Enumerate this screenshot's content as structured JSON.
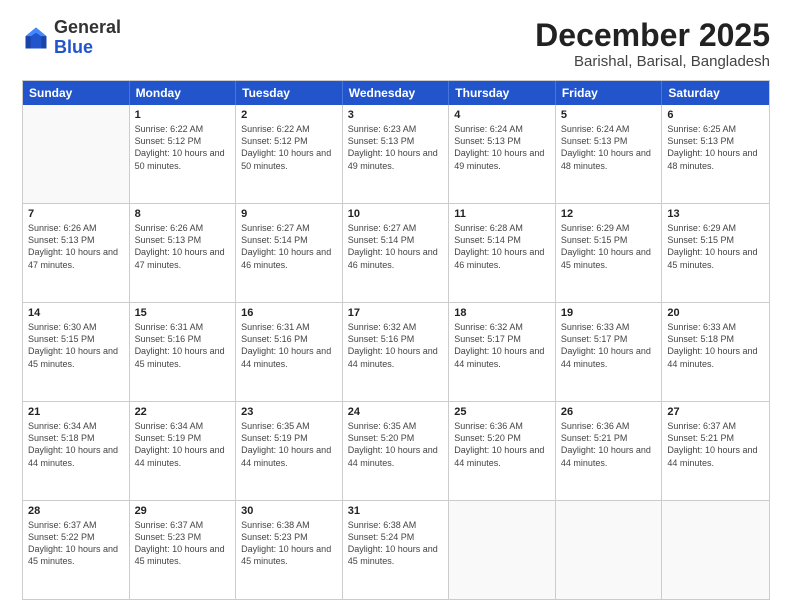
{
  "header": {
    "logo": {
      "line1": "General",
      "line2": "Blue"
    },
    "title": "December 2025",
    "location": "Barishal, Barisal, Bangladesh"
  },
  "weekdays": [
    "Sunday",
    "Monday",
    "Tuesday",
    "Wednesday",
    "Thursday",
    "Friday",
    "Saturday"
  ],
  "weeks": [
    [
      {
        "day": "",
        "empty": true
      },
      {
        "day": "1",
        "sunrise": "6:22 AM",
        "sunset": "5:12 PM",
        "daylight": "10 hours and 50 minutes."
      },
      {
        "day": "2",
        "sunrise": "6:22 AM",
        "sunset": "5:12 PM",
        "daylight": "10 hours and 50 minutes."
      },
      {
        "day": "3",
        "sunrise": "6:23 AM",
        "sunset": "5:13 PM",
        "daylight": "10 hours and 49 minutes."
      },
      {
        "day": "4",
        "sunrise": "6:24 AM",
        "sunset": "5:13 PM",
        "daylight": "10 hours and 49 minutes."
      },
      {
        "day": "5",
        "sunrise": "6:24 AM",
        "sunset": "5:13 PM",
        "daylight": "10 hours and 48 minutes."
      },
      {
        "day": "6",
        "sunrise": "6:25 AM",
        "sunset": "5:13 PM",
        "daylight": "10 hours and 48 minutes."
      }
    ],
    [
      {
        "day": "7",
        "sunrise": "6:26 AM",
        "sunset": "5:13 PM",
        "daylight": "10 hours and 47 minutes."
      },
      {
        "day": "8",
        "sunrise": "6:26 AM",
        "sunset": "5:13 PM",
        "daylight": "10 hours and 47 minutes."
      },
      {
        "day": "9",
        "sunrise": "6:27 AM",
        "sunset": "5:14 PM",
        "daylight": "10 hours and 46 minutes."
      },
      {
        "day": "10",
        "sunrise": "6:27 AM",
        "sunset": "5:14 PM",
        "daylight": "10 hours and 46 minutes."
      },
      {
        "day": "11",
        "sunrise": "6:28 AM",
        "sunset": "5:14 PM",
        "daylight": "10 hours and 46 minutes."
      },
      {
        "day": "12",
        "sunrise": "6:29 AM",
        "sunset": "5:15 PM",
        "daylight": "10 hours and 45 minutes."
      },
      {
        "day": "13",
        "sunrise": "6:29 AM",
        "sunset": "5:15 PM",
        "daylight": "10 hours and 45 minutes."
      }
    ],
    [
      {
        "day": "14",
        "sunrise": "6:30 AM",
        "sunset": "5:15 PM",
        "daylight": "10 hours and 45 minutes."
      },
      {
        "day": "15",
        "sunrise": "6:31 AM",
        "sunset": "5:16 PM",
        "daylight": "10 hours and 45 minutes."
      },
      {
        "day": "16",
        "sunrise": "6:31 AM",
        "sunset": "5:16 PM",
        "daylight": "10 hours and 44 minutes."
      },
      {
        "day": "17",
        "sunrise": "6:32 AM",
        "sunset": "5:16 PM",
        "daylight": "10 hours and 44 minutes."
      },
      {
        "day": "18",
        "sunrise": "6:32 AM",
        "sunset": "5:17 PM",
        "daylight": "10 hours and 44 minutes."
      },
      {
        "day": "19",
        "sunrise": "6:33 AM",
        "sunset": "5:17 PM",
        "daylight": "10 hours and 44 minutes."
      },
      {
        "day": "20",
        "sunrise": "6:33 AM",
        "sunset": "5:18 PM",
        "daylight": "10 hours and 44 minutes."
      }
    ],
    [
      {
        "day": "21",
        "sunrise": "6:34 AM",
        "sunset": "5:18 PM",
        "daylight": "10 hours and 44 minutes."
      },
      {
        "day": "22",
        "sunrise": "6:34 AM",
        "sunset": "5:19 PM",
        "daylight": "10 hours and 44 minutes."
      },
      {
        "day": "23",
        "sunrise": "6:35 AM",
        "sunset": "5:19 PM",
        "daylight": "10 hours and 44 minutes."
      },
      {
        "day": "24",
        "sunrise": "6:35 AM",
        "sunset": "5:20 PM",
        "daylight": "10 hours and 44 minutes."
      },
      {
        "day": "25",
        "sunrise": "6:36 AM",
        "sunset": "5:20 PM",
        "daylight": "10 hours and 44 minutes."
      },
      {
        "day": "26",
        "sunrise": "6:36 AM",
        "sunset": "5:21 PM",
        "daylight": "10 hours and 44 minutes."
      },
      {
        "day": "27",
        "sunrise": "6:37 AM",
        "sunset": "5:21 PM",
        "daylight": "10 hours and 44 minutes."
      }
    ],
    [
      {
        "day": "28",
        "sunrise": "6:37 AM",
        "sunset": "5:22 PM",
        "daylight": "10 hours and 45 minutes."
      },
      {
        "day": "29",
        "sunrise": "6:37 AM",
        "sunset": "5:23 PM",
        "daylight": "10 hours and 45 minutes."
      },
      {
        "day": "30",
        "sunrise": "6:38 AM",
        "sunset": "5:23 PM",
        "daylight": "10 hours and 45 minutes."
      },
      {
        "day": "31",
        "sunrise": "6:38 AM",
        "sunset": "5:24 PM",
        "daylight": "10 hours and 45 minutes."
      },
      {
        "day": "",
        "empty": true
      },
      {
        "day": "",
        "empty": true
      },
      {
        "day": "",
        "empty": true
      }
    ]
  ]
}
